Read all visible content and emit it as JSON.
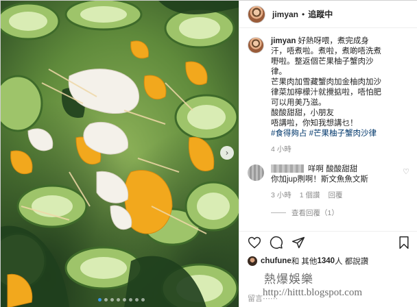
{
  "post": {
    "username": "jimyan",
    "separator": "•",
    "follow_label": "追蹤中"
  },
  "caption": {
    "username": "jimyan",
    "lines": [
      "好熱呀喂，煮完成身",
      "汗，唔煮啦。煮啦，煮啲唔洗煮",
      "嘢啦。整返個芒果柚子蟹肉沙",
      "律。",
      "芒果肉加雪藏蟹肉加金柚肉加沙",
      "律菜加檸檬汁就攪掂啦，唔怕肥",
      "可以用美乃滋。",
      "酸酸甜甜，小朋友",
      "唔講啦，你知我想講乜！"
    ],
    "hashtags": "#食得夠占 #芒果柚子蟹肉沙律",
    "time": "4 小時"
  },
  "comment": {
    "line1": "咩啊 酸酸甜甜",
    "line2": "你加jup𠝹啊！斯文魚魚文斯",
    "time": "3 小時",
    "likes": "1 個讚",
    "reply": "回覆",
    "view_replies": "查看回覆（1）"
  },
  "likes": {
    "user": "chufune",
    "text": " 和 其他 ",
    "count": "1340",
    "suffix": " 人 都說讚"
  },
  "add_comment_placeholder": "留言⋯⋯",
  "watermark": {
    "line1": "熱爆娛樂",
    "line2": "http://hittt.blogspot.com"
  },
  "carousel": {
    "total": 8,
    "active_index": 0
  },
  "icons": [
    "heart-icon",
    "comment-icon",
    "share-icon",
    "save-icon",
    "next-arrow-icon"
  ],
  "colors": {
    "hashtag": "#00376b",
    "active_dot": "#3b97e6",
    "muted": "#8e8e8e"
  }
}
